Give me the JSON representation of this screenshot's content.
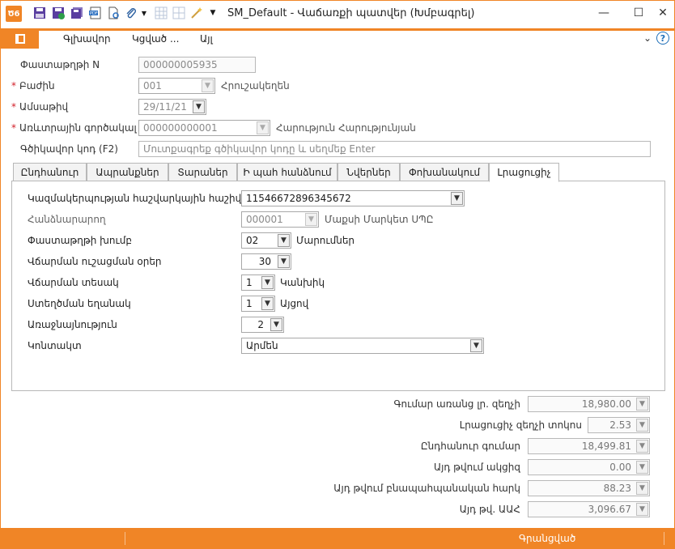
{
  "window": {
    "title": "SM_Default - Վաճառքի պատվեր (Խմբագրել)",
    "logo": "Ծ6",
    "minimize": "—",
    "maximize": "☐",
    "close": "✕"
  },
  "toolbar": {
    "icons": [
      "save-icon",
      "save-close-icon",
      "save-all-icon",
      "pdf-icon",
      "copy-document-icon",
      "attach-icon",
      "grid-icon",
      "grid-alt-icon",
      "magic-wand-icon",
      "dropdown-arrow-icon"
    ]
  },
  "menu": {
    "items": [
      "Գլխավոր",
      "Կցված ...",
      "Այլ"
    ],
    "chevron": "⌄",
    "help": "?"
  },
  "header": {
    "doc_number_label": "Փաստաթղթի N",
    "doc_number": "000000005935",
    "department_label": "Բաժին",
    "department_code": "001",
    "department_name": "Հրուշակեղեն",
    "date_label": "Ամսաթիվ",
    "date": "29/11/21",
    "partner_label": "Առևտրային գործակալ",
    "partner_code": "000000000001",
    "partner_name": "Հարություն Հարությունյան",
    "barcode_label": "Գծիկավոր կոդ (F2)",
    "barcode_placeholder": "Մուտքագրեք գծիկավոր կոդը և սեղմեք Enter"
  },
  "tabs": [
    "Ընդհանուր",
    "Ապրանքներ",
    "Տարաներ",
    "Ի պահ հանձնում",
    "Նվերներ",
    "Փոխանակում",
    "Լրացուցիչ"
  ],
  "active_tab": 6,
  "extra": {
    "account_label": "Կազմակերպության հաշվարկային հաշիվ",
    "account_value": "11546672896345672",
    "customer_label": "Հանձնարարող",
    "customer_code": "000001",
    "customer_name": "Մաքսի Մարկետ ՍՊԸ",
    "doc_group_label": "Փաստաթղթի խումբ",
    "doc_group_code": "02",
    "doc_group_name": "Մարումներ",
    "payment_delay_label": "Վճարման ուշացման օրեր",
    "payment_delay": "30",
    "payment_type_label": "Վճարման տեսակ",
    "payment_type_code": "1",
    "payment_type_name": "Կանխիկ",
    "receipt_method_label": "Ստեղծման եղանակ",
    "receipt_method_code": "1",
    "receipt_method_name": "Այցով",
    "priority_label": "Առաջնայնություն",
    "priority": "2",
    "contact_label": "Կոնտակտ",
    "contact_value": "Արմեն"
  },
  "totals": [
    {
      "label": "Գումար առանց լր. զեղչի",
      "value": "18,980.00"
    },
    {
      "label": "Լրացուցիչ զեղչի տոկոս",
      "value": "2.53"
    },
    {
      "label": "Ընդհանուր գումար",
      "value": "18,499.81"
    },
    {
      "label": "Այդ թվում ակցիզ",
      "value": "0.00"
    },
    {
      "label": "Այդ թվում բնապահպանական հարկ",
      "value": "88.23"
    },
    {
      "label": "Այդ թվ. ԱԱՀ",
      "value": "3,096.67"
    }
  ],
  "status": {
    "text": "Գրանցված"
  },
  "colors": {
    "accent": "#f08526",
    "required": "#d2202a",
    "help": "#1f6fb8"
  }
}
